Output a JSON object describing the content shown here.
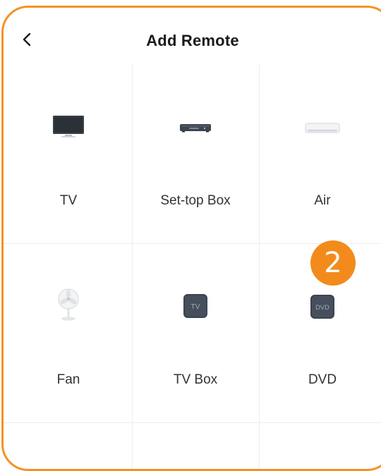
{
  "header": {
    "title": "Add Remote"
  },
  "devices": [
    {
      "label": "TV",
      "icon": "tv-icon"
    },
    {
      "label": "Set-top Box",
      "icon": "set-top-box-icon"
    },
    {
      "label": "Air",
      "icon": "air-conditioner-icon"
    },
    {
      "label": "Fan",
      "icon": "fan-icon"
    },
    {
      "label": "TV Box",
      "icon": "tv-box-icon",
      "icon_text": "TV"
    },
    {
      "label": "DVD",
      "icon": "dvd-icon",
      "icon_text": "DVD"
    }
  ],
  "step_badge": {
    "number": "2",
    "color": "#f28b1c"
  },
  "colors": {
    "border_accent": "#f39325",
    "divider": "#ececec"
  }
}
